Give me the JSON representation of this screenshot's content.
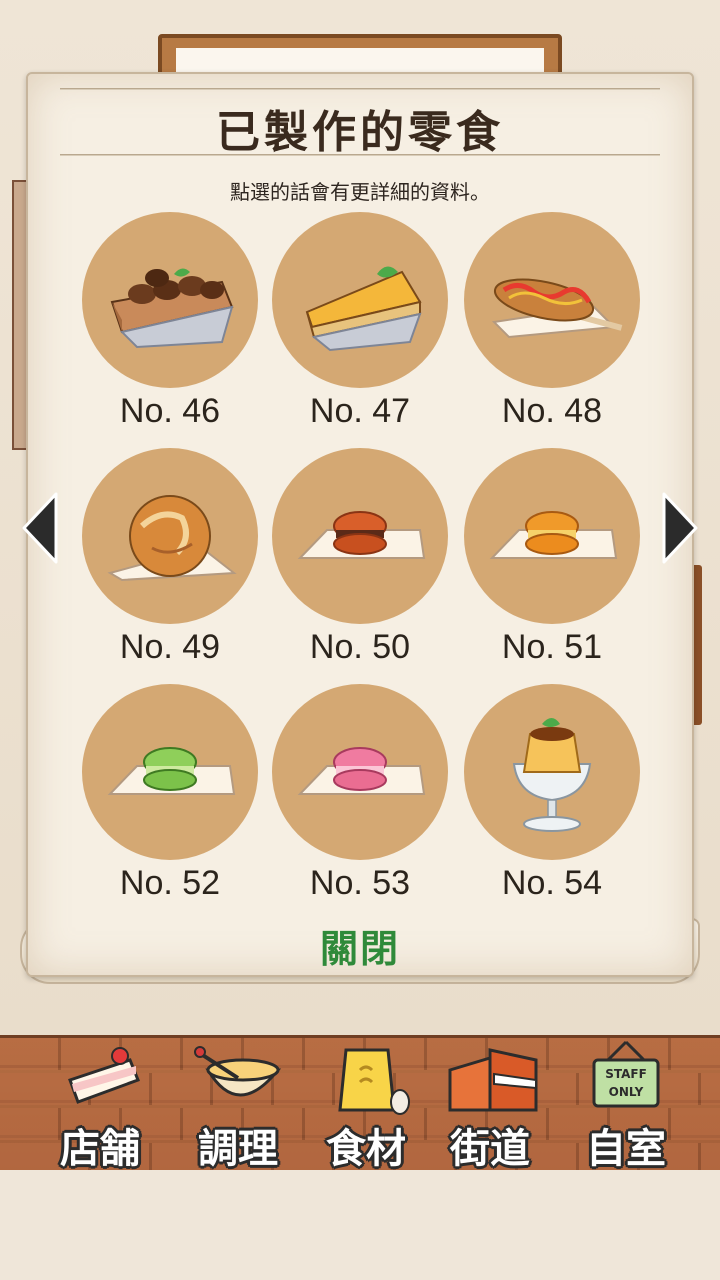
{
  "panel": {
    "title": "已製作的零食",
    "subtitle": "點選的話會有更詳細的資料。",
    "close_label": "關閉"
  },
  "items": [
    {
      "label": "No. 46",
      "food": "chocolate-tart"
    },
    {
      "label": "No. 47",
      "food": "mango-tart"
    },
    {
      "label": "No. 48",
      "food": "corn-dog"
    },
    {
      "label": "No. 49",
      "food": "cream-puff"
    },
    {
      "label": "No. 50",
      "food": "brown-macaron"
    },
    {
      "label": "No. 51",
      "food": "orange-macaron"
    },
    {
      "label": "No. 52",
      "food": "green-macaron"
    },
    {
      "label": "No. 53",
      "food": "pink-macaron"
    },
    {
      "label": "No. 54",
      "food": "pudding"
    }
  ],
  "nav": {
    "items": [
      {
        "label": "店舗",
        "icon": "cake-icon"
      },
      {
        "label": "調理",
        "icon": "mixing-bowl-icon"
      },
      {
        "label": "食材",
        "icon": "flour-bag-icon"
      },
      {
        "label": "街道",
        "icon": "street-icon"
      },
      {
        "label": "自室",
        "icon": "staff-only-sign-icon",
        "sign_text": "STAFF ONLY"
      }
    ]
  },
  "colors": {
    "circle": "#d4a873",
    "close_label": "#2f8a3a",
    "panel": "#f6efe3"
  }
}
